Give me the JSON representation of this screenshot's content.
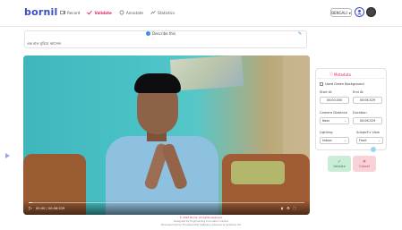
{
  "app": {
    "brand": "bornil"
  },
  "nav": [
    {
      "label": "Record",
      "icon": "record-icon"
    },
    {
      "label": "Validate",
      "icon": "validate-icon",
      "active": true
    },
    {
      "label": "Annotate",
      "icon": "annotate-icon"
    },
    {
      "label": "Statistics",
      "icon": "statistics-icon"
    }
  ],
  "header": {
    "language": "BENGALI"
  },
  "task": {
    "describe_label": "Describe this",
    "sentence": "এক হাত ঘুরিয়ে আসেন।"
  },
  "video": {
    "time": "00:00 / 00:06:529"
  },
  "metadata": {
    "title": "Metadata",
    "green_background_label": "Used Green Background",
    "start_at_label": "Start At",
    "start_at_value": "00:00.000",
    "end_at_label": "End At",
    "end_at_value": "00:06.529",
    "camera_distance_label": "Camera Distance",
    "camera_distance_value": "Near",
    "duration_label": "Duration",
    "duration_value": "00:06.529",
    "lighting_label": "Lighting",
    "lighting_value": "Indoor",
    "subject_view_label": "Subject's View",
    "subject_view_value": "Front"
  },
  "actions": {
    "validate_label": "Validate",
    "cancel_label": "Cancel"
  },
  "footer": {
    "line1": "© 2022 Bornil. All rights reserved.",
    "line2": "Designed by Engineering Innovation Centre",
    "line3": "Development by Fundamental Software Advisors & Systems Ltd"
  },
  "colors": {
    "brand": "#3b4fc4",
    "accent": "#e0245e",
    "validate_bg": "#c9edd6",
    "cancel_bg": "#f8d2d8"
  }
}
